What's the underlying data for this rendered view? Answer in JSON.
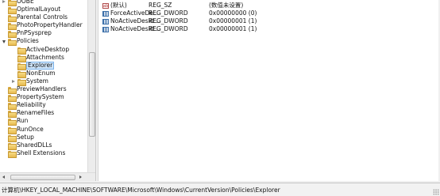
{
  "tree": {
    "items": [
      {
        "label": "OOBE",
        "level": 0,
        "expander": "collapsed"
      },
      {
        "label": "OptimalLayout",
        "level": 0,
        "expander": "none"
      },
      {
        "label": "Parental Controls",
        "level": 0,
        "expander": "none"
      },
      {
        "label": "PhotoPropertyHandler",
        "level": 0,
        "expander": "none"
      },
      {
        "label": "PnPSysprep",
        "level": 0,
        "expander": "none"
      },
      {
        "label": "Policies",
        "level": 0,
        "expander": "expanded"
      },
      {
        "label": "ActiveDesktop",
        "level": 1,
        "expander": "none"
      },
      {
        "label": "Attachments",
        "level": 1,
        "expander": "none"
      },
      {
        "label": "Explorer",
        "level": 1,
        "expander": "none",
        "selected": true
      },
      {
        "label": "NonEnum",
        "level": 1,
        "expander": "none"
      },
      {
        "label": "System",
        "level": 1,
        "expander": "collapsed"
      },
      {
        "label": "PreviewHandlers",
        "level": 0,
        "expander": "none"
      },
      {
        "label": "PropertySystem",
        "level": 0,
        "expander": "none"
      },
      {
        "label": "Reliability",
        "level": 0,
        "expander": "none"
      },
      {
        "label": "RenameFiles",
        "level": 0,
        "expander": "none"
      },
      {
        "label": "Run",
        "level": 0,
        "expander": "none"
      },
      {
        "label": "RunOnce",
        "level": 0,
        "expander": "none"
      },
      {
        "label": "Setup",
        "level": 0,
        "expander": "none"
      },
      {
        "label": "SharedDLLs",
        "level": 0,
        "expander": "none"
      },
      {
        "label": "Shell Extensions",
        "level": 0,
        "expander": "none"
      }
    ]
  },
  "values": {
    "rows": [
      {
        "name": "(默认)",
        "type": "REG_SZ",
        "data": "(数值未设置)",
        "icon": "string-value-icon"
      },
      {
        "name": "ForceActiveDe...",
        "type": "REG_DWORD",
        "data": "0x00000000 (0)",
        "icon": "dword-value-icon"
      },
      {
        "name": "NoActiveDeskt...",
        "type": "REG_DWORD",
        "data": "0x00000001 (1)",
        "icon": "dword-value-icon"
      },
      {
        "name": "NoActiveDeskt...",
        "type": "REG_DWORD",
        "data": "0x00000001 (1)",
        "icon": "dword-value-icon"
      }
    ]
  },
  "status": {
    "path": "计算机\\HKEY_LOCAL_MACHINE\\SOFTWARE\\Microsoft\\Windows\\CurrentVersion\\Policies\\Explorer"
  }
}
